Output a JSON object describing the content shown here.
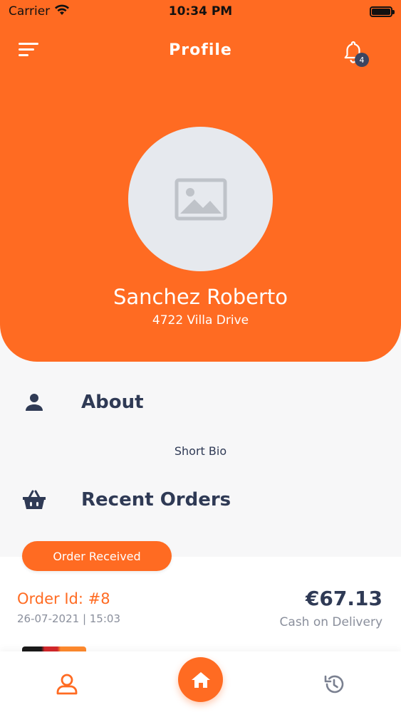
{
  "status_bar": {
    "carrier": "Carrier",
    "time": "10:34 PM"
  },
  "header": {
    "title": "Profile",
    "notification_count": "4"
  },
  "profile": {
    "name": "Sanchez Roberto",
    "address": "4722 Villa Drive"
  },
  "about": {
    "title": "About",
    "bio": "Short Bio"
  },
  "recent_orders": {
    "title": "Recent Orders",
    "orders": [
      {
        "status": "Order Received",
        "order_id": "Order Id: #8",
        "date": "26-07-2021 | 15:03",
        "amount": "€67.13",
        "payment": "Cash on Delivery"
      }
    ]
  },
  "bottom_nav": {
    "items": [
      {
        "icon": "user-icon",
        "active": true
      },
      {
        "icon": "home-icon",
        "active": false
      },
      {
        "icon": "history-icon",
        "active": false
      }
    ]
  },
  "colors": {
    "primary": "#ff6b22",
    "text_dark": "#2f3a55",
    "text_muted": "#8a8f9c",
    "badge": "#3c4560"
  }
}
